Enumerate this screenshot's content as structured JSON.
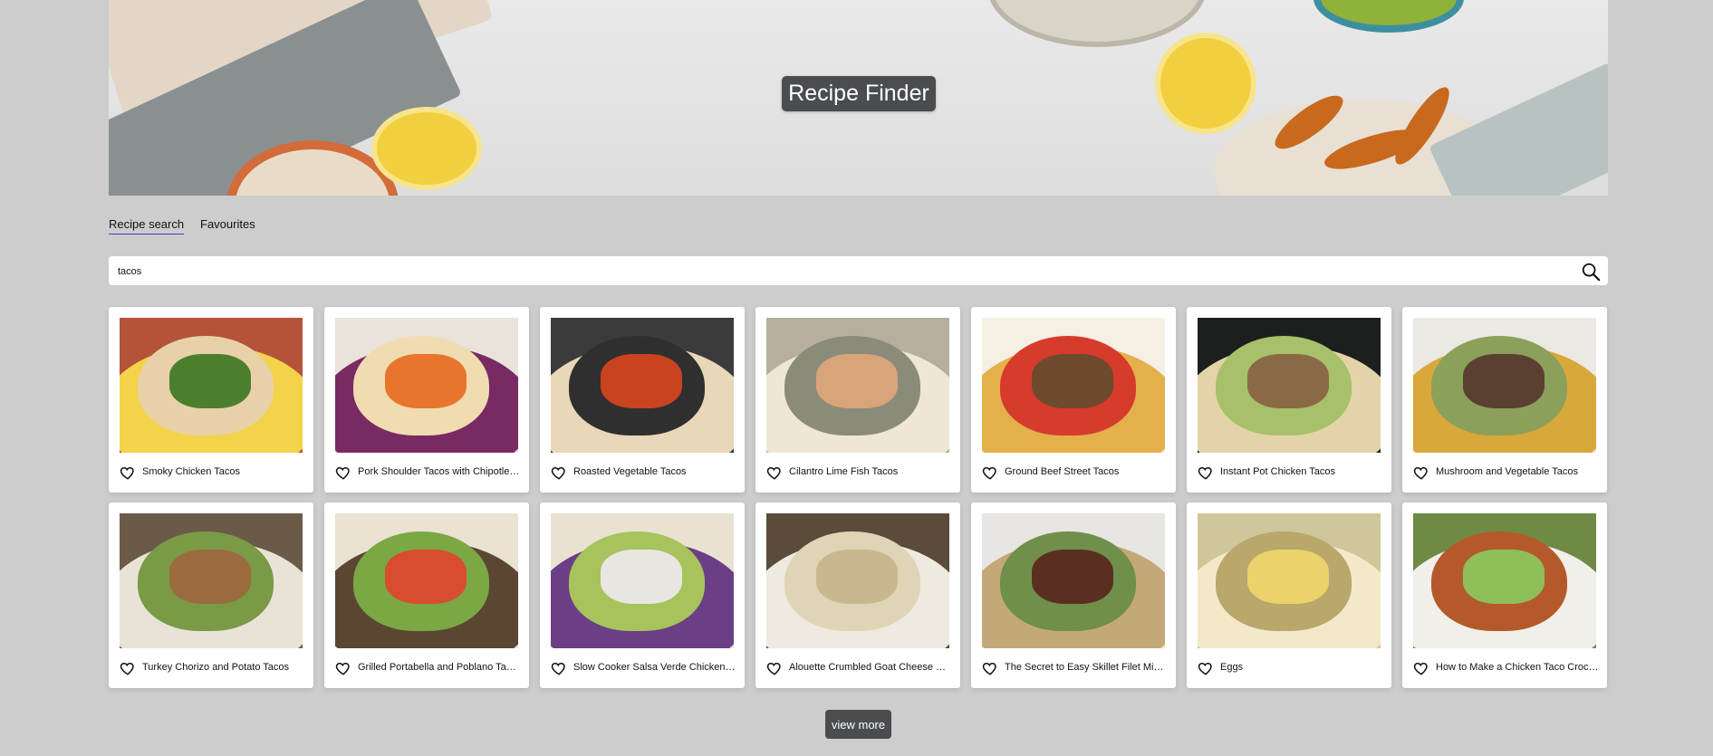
{
  "header": {
    "title": "Recipe Finder"
  },
  "tabs": [
    {
      "label": "Recipe search",
      "active": true
    },
    {
      "label": "Favourites",
      "active": false
    }
  ],
  "search": {
    "value": "tacos",
    "icon": "search-icon"
  },
  "recipes": [
    {
      "title": "Smoky Chicken Tacos"
    },
    {
      "title": "Pork Shoulder Tacos with Chipotle …"
    },
    {
      "title": "Roasted Vegetable Tacos"
    },
    {
      "title": "Cilantro Lime Fish Tacos"
    },
    {
      "title": "Ground Beef Street Tacos"
    },
    {
      "title": "Instant Pot Chicken Tacos"
    },
    {
      "title": "Mushroom and Vegetable Tacos"
    },
    {
      "title": "Turkey Chorizo and Potato Tacos"
    },
    {
      "title": "Grilled Portabella and Poblano Tacos"
    },
    {
      "title": "Slow Cooker Salsa Verde Chicken …"
    },
    {
      "title": "Alouette Crumbled Goat Cheese Pr…"
    },
    {
      "title": "The Secret to Easy Skillet Filet Mig…"
    },
    {
      "title": "Eggs"
    },
    {
      "title": "How to Make a Chicken Taco Crock…"
    }
  ],
  "view_more_label": "view more",
  "colors": {
    "page_background": "#cdcdcd",
    "title_badge": "#4a4c4f",
    "active_tab_underline": "#4a3bd6"
  }
}
